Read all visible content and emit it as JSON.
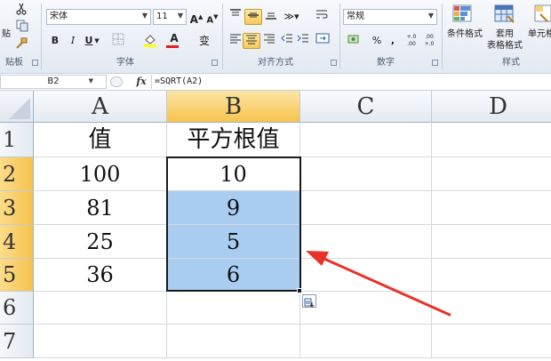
{
  "ribbon": {
    "clipboard": {
      "paste_label": "贴",
      "group_label": "贴板"
    },
    "font": {
      "name": "宋体",
      "size": "11",
      "grow_glyph": "A",
      "shrink_glyph": "A",
      "bold": "B",
      "italic": "I",
      "underline": "U",
      "font_color_glyph": "A",
      "phonetic_glyph": "变",
      "group_label": "字体"
    },
    "alignment": {
      "group_label": "对齐方式"
    },
    "number": {
      "format": "常规",
      "percent": "%",
      "comma": ",",
      "inc_decimal": "+.0 .00",
      "dec_decimal": ".00 +.0",
      "group_label": "数字"
    },
    "styles": {
      "conditional": "条件格式",
      "table_format_l1": "套用",
      "table_format_l2": "表格格式",
      "cell_styles": "单元格",
      "group_label": "样式"
    }
  },
  "formula_bar": {
    "name_box": "B2",
    "fx": "fx",
    "formula": "=SQRT(A2)"
  },
  "sheet": {
    "columns": [
      "A",
      "B",
      "C",
      "D"
    ],
    "rows": [
      "1",
      "2",
      "3",
      "4",
      "5",
      "6",
      "7"
    ],
    "cells": {
      "A1": "值",
      "B1": "平方根值",
      "A2": "100",
      "B2": "10",
      "A3": "81",
      "B3": "9",
      "A4": "25",
      "B4": "5",
      "A5": "36",
      "B5": "6"
    }
  },
  "colors": {
    "selection": "#a9cdf0",
    "header_selected": "#f6c44e",
    "arrow": "#e8322a"
  }
}
